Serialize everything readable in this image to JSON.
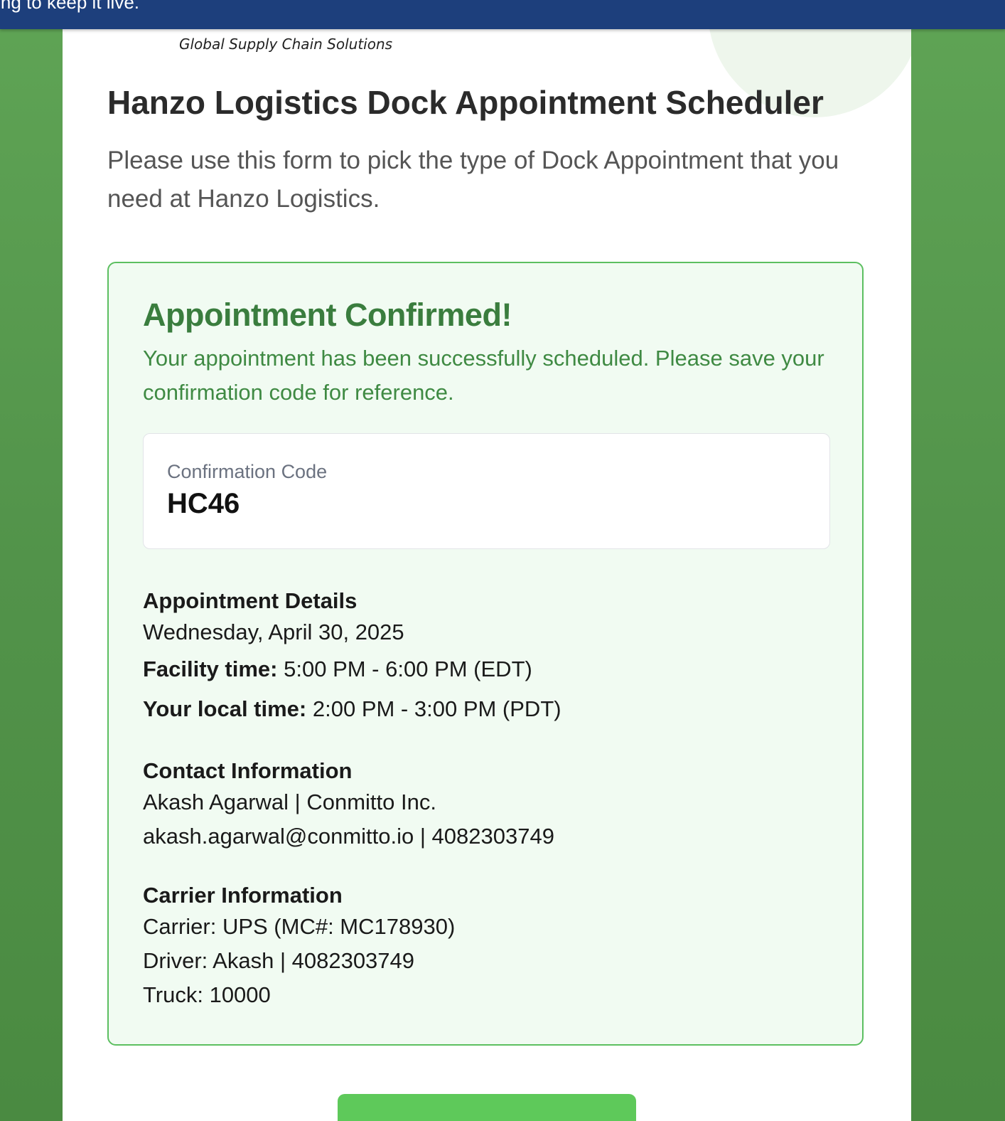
{
  "banner": {
    "text": "uring to keep it live."
  },
  "brand": {
    "tagline": "Global Supply Chain Solutions"
  },
  "page": {
    "title": "Hanzo Logistics Dock Appointment Scheduler",
    "intro": "Please use this form to pick the type of Dock Appointment that you need at Hanzo Logistics."
  },
  "confirmation": {
    "heading": "Appointment Confirmed!",
    "message": "Your appointment has been successfully scheduled. Please save your confirmation code for reference.",
    "code_label": "Confirmation Code",
    "code": "HC46"
  },
  "appointment_details": {
    "heading": "Appointment Details",
    "date": "Wednesday, April 30, 2025",
    "facility_time_label": "Facility time:",
    "facility_time": "5:00 PM - 6:00 PM (EDT)",
    "local_time_label": "Your local time:",
    "local_time": "2:00 PM - 3:00 PM (PDT)"
  },
  "contact_information": {
    "heading": "Contact Information",
    "name_company": "Akash Agarwal | Conmitto Inc.",
    "email_phone": "akash.agarwal@conmitto.io | 4082303749"
  },
  "carrier_information": {
    "heading": "Carrier Information",
    "carrier": "Carrier: UPS (MC#: MC178930)",
    "driver": "Driver: Akash | 4082303749",
    "truck": "Truck: 10000"
  },
  "colors": {
    "banner": "#1d3f7c",
    "background_green": "#52934a",
    "success_border": "#5cbf60",
    "success_heading": "#3a7d3e",
    "success_background": "#f1fbf2",
    "button": "#5ec95a"
  }
}
